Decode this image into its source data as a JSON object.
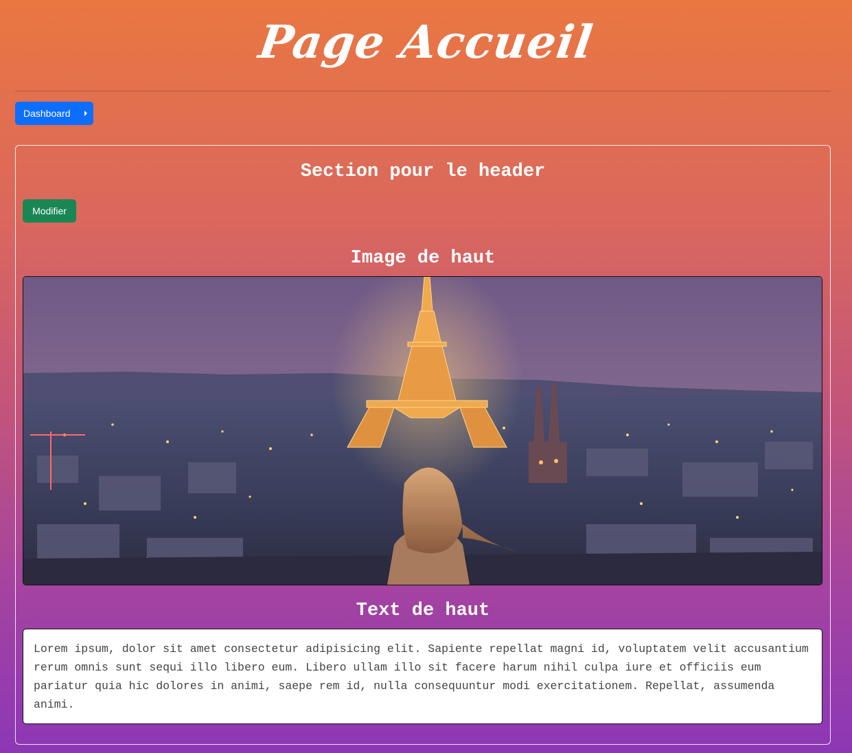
{
  "header": {
    "title": "Page Accueil"
  },
  "nav": {
    "dashboard_label": "Dashboard"
  },
  "section": {
    "title": "Section pour le header",
    "modify_label": "Modifier",
    "image_heading": "Image de haut",
    "image_alt": "Eiffel Tower at dusk over Paris",
    "text_heading": "Text de haut",
    "text_body": "Lorem ipsum, dolor sit amet consectetur adipisicing elit. Sapiente repellat magni id, voluptatem velit accusantium rerum omnis sunt sequi illo libero eum. Libero ullam illo sit facere harum nihil culpa iure et officiis eum pariatur quia hic dolores in animi, saepe rem id, nulla consequuntur modi exercitationem. Repellat, assumenda animi."
  },
  "colors": {
    "primary_button": "#0d6efd",
    "success_button": "#198754",
    "gradient_top": "#ea7741",
    "gradient_bottom": "#8c37b6"
  },
  "icons": {
    "dashboard_caret": "caret-right-icon"
  }
}
